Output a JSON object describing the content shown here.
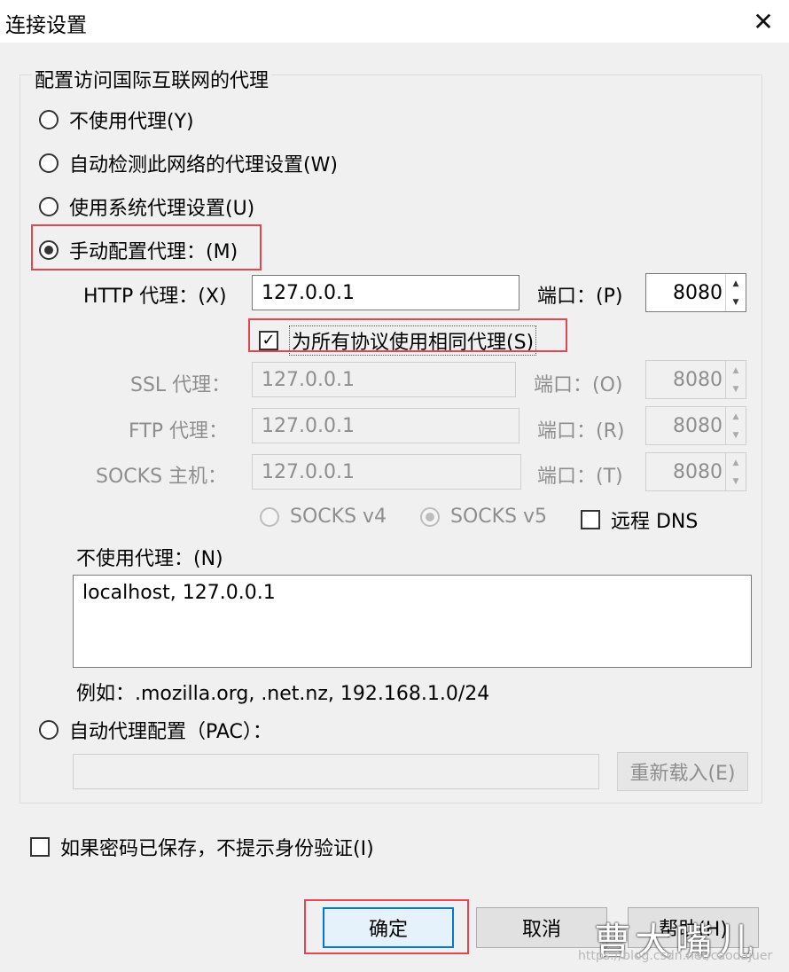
{
  "window": {
    "title": "连接设置",
    "close_glyph": "✕"
  },
  "group_label": "配置访问国际互联网的代理",
  "proxy_modes": [
    {
      "label": "不使用代理(Y)",
      "checked": false
    },
    {
      "label": "自动检测此网络的代理设置(W)",
      "checked": false
    },
    {
      "label": "使用系统代理设置(U)",
      "checked": false
    },
    {
      "label": "手动配置代理：(M)",
      "checked": true
    }
  ],
  "http": {
    "label": "HTTP 代理：(X)",
    "value": "127.0.0.1",
    "port_label": "端口：(P)",
    "port": "8080"
  },
  "same_proxy": {
    "label": "为所有协议使用相同代理(S)",
    "checked": true,
    "check_glyph": "✓"
  },
  "ssl": {
    "label": "SSL 代理：",
    "value": "127.0.0.1",
    "port_label": "端口：(O)",
    "port": "8080"
  },
  "ftp": {
    "label": "FTP 代理：",
    "value": "127.0.0.1",
    "port_label": "端口：(R)",
    "port": "8080"
  },
  "socks": {
    "label": "SOCKS 主机：",
    "value": "127.0.0.1",
    "port_label": "端口：(T)",
    "port": "8080"
  },
  "socks_versions": {
    "v4": "SOCKS v4",
    "v5": "SOCKS v5",
    "selected": "v5"
  },
  "remote_dns": {
    "label": "远程 DNS",
    "checked": false
  },
  "no_proxy": {
    "label": "不使用代理：(N)",
    "value": "localhost, 127.0.0.1",
    "example": "例如：.mozilla.org, .net.nz, 192.168.1.0/24"
  },
  "pac": {
    "label": "自动代理配置（PAC）：",
    "checked": false,
    "value": "",
    "reload_label": "重新载入(E)"
  },
  "no_auth_prompt": {
    "label": "如果密码已保存，不提示身份验证(I)",
    "checked": false
  },
  "buttons": {
    "ok": "确定",
    "cancel": "取消",
    "help": "帮助(H)"
  },
  "watermark": {
    "text": "曹大嘴儿",
    "url": "https://blog.csdn.net/caodajuer"
  },
  "spin_glyphs": {
    "up": "▲",
    "down": "▼"
  },
  "colors": {
    "highlight_box": "#e2464e",
    "default_button_border": "#0078d7"
  }
}
